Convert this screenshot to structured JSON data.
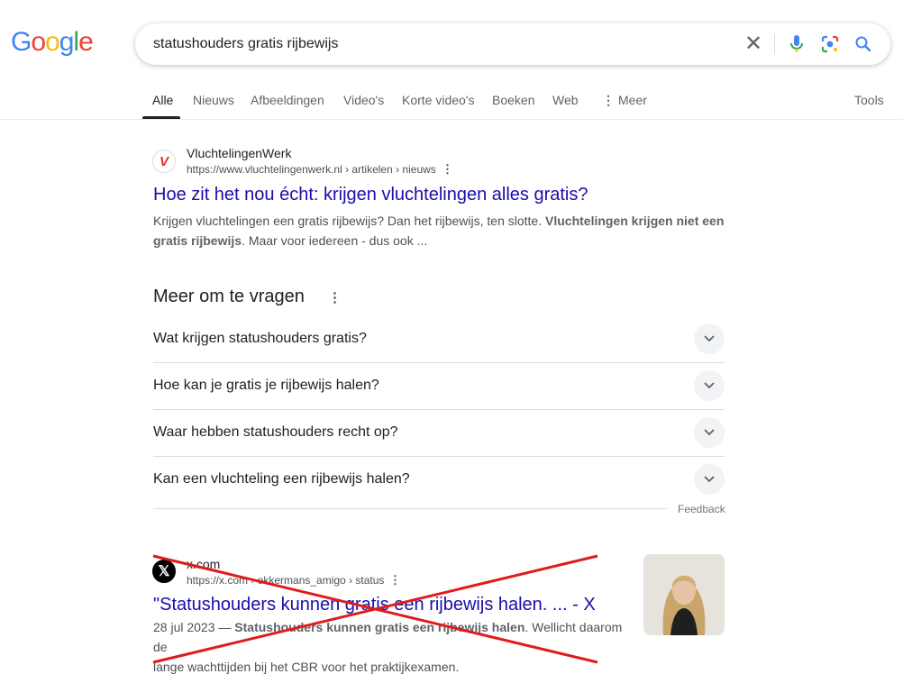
{
  "logo": {
    "text": "Google"
  },
  "search": {
    "query": "statushouders gratis rijbewijs"
  },
  "tabs": [
    {
      "label": "Alle"
    },
    {
      "label": "Nieuws"
    },
    {
      "label": "Afbeeldingen"
    },
    {
      "label": "Video's"
    },
    {
      "label": "Korte video's"
    },
    {
      "label": "Boeken"
    },
    {
      "label": "Web"
    },
    {
      "label": "Meer"
    }
  ],
  "tools_label": "Tools",
  "results": [
    {
      "site_name": "VluchtelingenWerk",
      "url": "https://www.vluchtelingenwerk.nl › artikelen › nieuws",
      "title": "Hoe zit het nou écht: krijgen vluchtelingen alles gratis?",
      "snippet_1a": "Krijgen vluchtelingen een gratis rijbewijs? Dan het rijbewijs, ten slotte. ",
      "snippet_1b": "Vluchtelingen krijgen niet een",
      "snippet_2a": "gratis rijbewijs",
      "snippet_2b": ". Maar voor iedereen - dus ook ..."
    },
    {
      "site_name": "x.com",
      "url": "https://x.com › ekkermans_amigo › status",
      "title": "\"Statushouders kunnen gratis een rijbewijs halen. ... - X",
      "snippet_1a": "28 jul 2023 — ",
      "snippet_1b": "Statushouders kunnen gratis een rijbewijs halen",
      "snippet_1c": ". Wellicht daarom de",
      "snippet_2": "lange wachttijden bij het CBR voor het praktijkexamen."
    }
  ],
  "paa": {
    "heading": "Meer om te vragen",
    "questions": [
      "Wat krijgen statushouders gratis?",
      "Hoe kan je gratis je rijbewijs halen?",
      "Waar hebben statushouders recht op?",
      "Kan een vluchteling een rijbewijs halen?"
    ],
    "feedback": "Feedback"
  },
  "colors": {
    "link": "#1a0dab",
    "strike": "#e01b1b"
  }
}
